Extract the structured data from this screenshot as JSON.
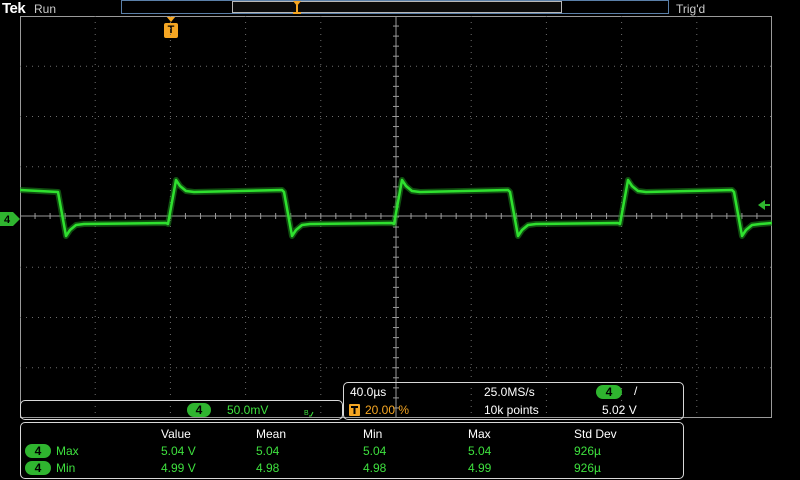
{
  "top": {
    "logo": "Tek",
    "run_state": "Run",
    "trigger_state": "Trig'd"
  },
  "trigger_marker": "T",
  "channel": {
    "number": "4",
    "scale": "50.0mV",
    "bw_icon": "bandwidth-limit-icon",
    "color": "#3ee03e"
  },
  "timebase": {
    "horizontal_scale": "40.0µs",
    "sample_rate": "25.0MS/s",
    "trigger_position": "20.00 %",
    "record_length": "10k points",
    "trigger_channel": "4",
    "trigger_slope": "/",
    "trigger_level": "5.02 V"
  },
  "measurements": {
    "headers": [
      "Value",
      "Mean",
      "Min",
      "Max",
      "Std Dev"
    ],
    "rows": [
      {
        "channel": "4",
        "name": "Max",
        "values": [
          "5.04 V",
          "5.04",
          "5.04",
          "5.04",
          "926µ"
        ]
      },
      {
        "channel": "4",
        "name": "Min",
        "values": [
          "4.99 V",
          "4.98",
          "4.98",
          "4.99",
          "926µ"
        ]
      }
    ]
  },
  "colors": {
    "trace": "#2fe02f",
    "trigger": "#f5a623",
    "record_bar": "#5a7fa8",
    "graticule": "#9a9a9a"
  }
}
